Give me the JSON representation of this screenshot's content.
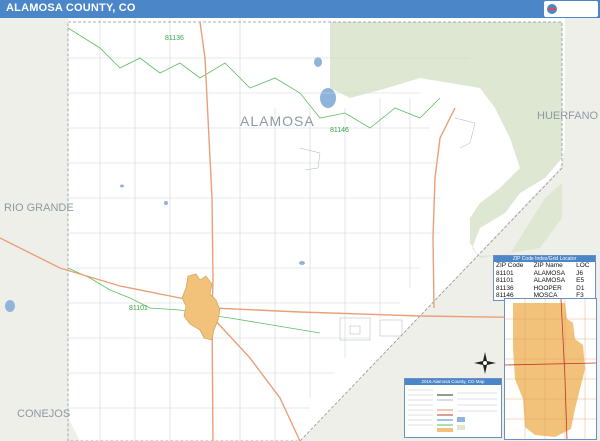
{
  "title": "ALAMOSA COUNTY, CO",
  "map_labels": {
    "county": "ALAMOSA",
    "huerfano": "HUERFANO",
    "rio_grande": "RIO GRANDE",
    "conejos": "CONEJOS"
  },
  "zip_labels": [
    "81136",
    "81146",
    "81101"
  ],
  "zip_index": {
    "header": "ZIP Code Index/Grid Locator",
    "columns": [
      "ZIP Code",
      "ZIP Name",
      "LOC"
    ],
    "rows": [
      [
        "81101",
        "ALAMOSA",
        "J6"
      ],
      [
        "81101",
        "ALAMOSA",
        "E5"
      ],
      [
        "81136",
        "HOOPER",
        "D1"
      ],
      [
        "81146",
        "MOSCA",
        "F3"
      ]
    ]
  },
  "legend": {
    "header": "2016 Alamosa County, CO Map"
  },
  "colors": {
    "title_bar": "#4a86c8",
    "land": "#ffffff",
    "park": "#dde7d2",
    "neighbor": "#efefea",
    "city": "#f2c27a",
    "water": "#8fb4dc",
    "zip_boundary": "#5fbf62",
    "road_major": "#e9a07a",
    "road_minor": "#cfd5db"
  },
  "icons": {
    "logo": "market-maps-logo",
    "compass": "compass-rose-icon"
  }
}
